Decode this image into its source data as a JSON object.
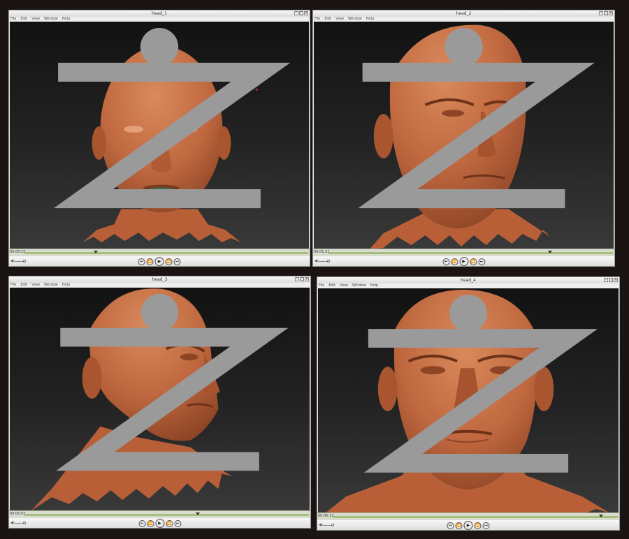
{
  "windows": [
    {
      "title": "head_1",
      "menu": [
        "File",
        "Edit",
        "View",
        "Window",
        "Help"
      ],
      "timecode": "00:00:15",
      "progress": 0.25,
      "head": "front-neutral"
    },
    {
      "title": "head_2",
      "menu": [
        "File",
        "Edit",
        "View",
        "Window",
        "Help"
      ],
      "timecode": "00:01:21",
      "progress": 0.78,
      "head": "three-quarter-left"
    },
    {
      "title": "head_3",
      "menu": [
        "File",
        "Edit",
        "View",
        "Window",
        "Help"
      ],
      "timecode": "00:00:02",
      "progress": 0.61,
      "head": "profile-right"
    },
    {
      "title": "head_4",
      "menu": [
        "File",
        "Edit",
        "View",
        "Window",
        "Help"
      ],
      "timecode": "00:00:13",
      "progress": 0.94,
      "head": "front-detailed"
    }
  ],
  "controls": {
    "prev_icon": "⏮",
    "rewind_icon": "⏪",
    "play_icon": "▶",
    "forward_icon": "⏩",
    "next_icon": "⏭",
    "volume_icon": "◀)"
  },
  "colors": {
    "skin": "#c0683f",
    "skin_dark": "#8e4526",
    "skin_light": "#d98a5c",
    "background": "#1a1413",
    "timeline_track": "#a5be7c"
  }
}
